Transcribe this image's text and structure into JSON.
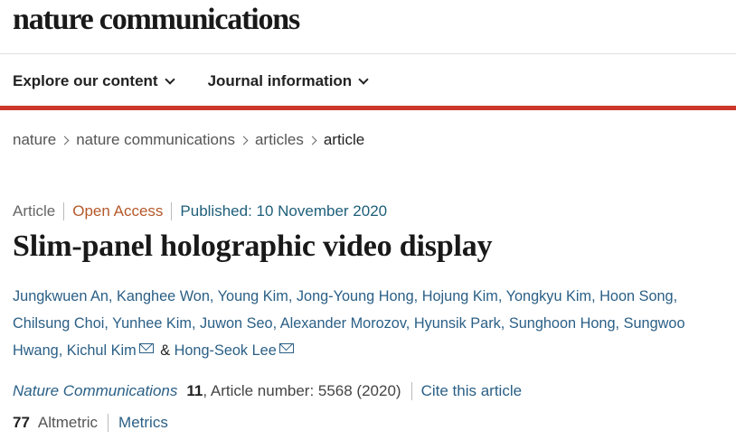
{
  "header": {
    "brand": "nature communications"
  },
  "nav": {
    "items": [
      {
        "label": "Explore our content",
        "icon": "chevron-down-icon"
      },
      {
        "label": "Journal information",
        "icon": "chevron-down-icon"
      }
    ]
  },
  "breadcrumb": {
    "items": [
      "nature",
      "nature communications",
      "articles"
    ],
    "current": "article",
    "separator_icon": "chevron-right-icon"
  },
  "article": {
    "type": "Article",
    "access": "Open Access",
    "published": "Published: 10 November 2020",
    "title": "Slim-panel holographic video display",
    "authors": [
      "Jungkwuen An",
      "Kanghee Won",
      "Young Kim",
      "Jong-Young Hong",
      "Hojung Kim",
      "Yongkyu Kim",
      "Hoon Song",
      "Chilsung Choi",
      "Yunhee Kim",
      "Juwon Seo",
      "Alexander Morozov",
      "Hyunsik Park",
      "Sunghoon Hong",
      "Sungwoo Hwang",
      "Kichul Kim",
      "Hong-Seok Lee"
    ],
    "author_separator": ",",
    "ampersand": "&",
    "journal": "Nature Communications",
    "volume": "11",
    "article_number": ", Article number: 5568 (2020)",
    "cite_label": "Cite this article",
    "altmetric_value": "77",
    "altmetric_label": "Altmetric",
    "metrics_label": "Metrics"
  },
  "colors": {
    "accent_red": "#cc3729",
    "link_blue": "#2a5f86",
    "open_access": "#b5592b"
  }
}
